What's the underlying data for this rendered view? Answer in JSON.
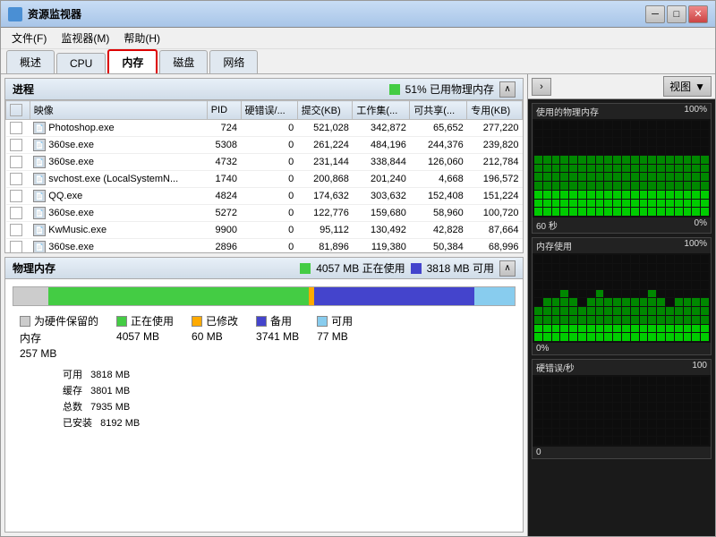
{
  "window": {
    "title": "资源监视器",
    "controls": {
      "minimize": "─",
      "maximize": "□",
      "close": "✕"
    }
  },
  "menu": {
    "items": [
      "文件(F)",
      "监视器(M)",
      "帮助(H)"
    ]
  },
  "tabs": [
    {
      "id": "overview",
      "label": "概述"
    },
    {
      "id": "cpu",
      "label": "CPU"
    },
    {
      "id": "memory",
      "label": "内存",
      "active": true
    },
    {
      "id": "disk",
      "label": "磁盘"
    },
    {
      "id": "network",
      "label": "网络"
    }
  ],
  "process_section": {
    "title": "进程",
    "memory_percent": "51% 已用物理内存",
    "columns": [
      "映像",
      "PID",
      "硬错误/...",
      "提交(KB)",
      "工作集(...",
      "可共享(...",
      "专用(KB)"
    ],
    "rows": [
      {
        "name": "Photoshop.exe",
        "pid": "724",
        "hard_fault": "0",
        "commit": "521,028",
        "working": "342,872",
        "shareable": "65,652",
        "private": "277,220"
      },
      {
        "name": "360se.exe",
        "pid": "5308",
        "hard_fault": "0",
        "commit": "261,224",
        "working": "484,196",
        "shareable": "244,376",
        "private": "239,820"
      },
      {
        "name": "360se.exe",
        "pid": "4732",
        "hard_fault": "0",
        "commit": "231,144",
        "working": "338,844",
        "shareable": "126,060",
        "private": "212,784"
      },
      {
        "name": "svchost.exe (LocalSystemN...",
        "pid": "1740",
        "hard_fault": "0",
        "commit": "200,868",
        "working": "201,240",
        "shareable": "4,668",
        "private": "196,572"
      },
      {
        "name": "QQ.exe",
        "pid": "4824",
        "hard_fault": "0",
        "commit": "174,632",
        "working": "303,632",
        "shareable": "152,408",
        "private": "151,224"
      },
      {
        "name": "360se.exe",
        "pid": "5272",
        "hard_fault": "0",
        "commit": "122,776",
        "working": "159,680",
        "shareable": "58,960",
        "private": "100,720"
      },
      {
        "name": "KwMusic.exe",
        "pid": "9900",
        "hard_fault": "0",
        "commit": "95,112",
        "working": "130,492",
        "shareable": "42,828",
        "private": "87,664"
      },
      {
        "name": "360se.exe",
        "pid": "2896",
        "hard_fault": "0",
        "commit": "81,896",
        "working": "119,380",
        "shareable": "50,384",
        "private": "68,996"
      }
    ]
  },
  "physical_memory": {
    "title": "物理内存",
    "in_use_label": "4057 MB 正在使用",
    "available_label": "3818 MB 可用",
    "legend": {
      "hardware_label": "为硬件保留的\n内存",
      "hardware_value": "257 MB",
      "inuse_label": "正在使用",
      "inuse_value": "4057 MB",
      "modified_label": "已修改",
      "modified_value": "60 MB",
      "standby_label": "备用",
      "standby_value": "3741 MB",
      "free_label": "可用",
      "free_value": "77 MB"
    },
    "stats": {
      "available_label": "可用",
      "available_value": "3818 MB",
      "cached_label": "缓存",
      "cached_value": "3801 MB",
      "total_label": "总数",
      "total_value": "7935 MB",
      "installed_label": "已安装",
      "installed_value": "8192 MB"
    }
  },
  "right_panel": {
    "graphs": [
      {
        "id": "physical_memory_used",
        "label_left": "使用的物理内存",
        "label_right": "100%",
        "label_bottom": "0%",
        "time_label": "60 秒"
      },
      {
        "id": "memory_usage",
        "label_left": "内存使用",
        "label_right": "100%",
        "label_bottom": "0%"
      },
      {
        "id": "hard_fault",
        "label_left": "硬错误/秒",
        "label_right": "100",
        "label_bottom": "0"
      }
    ],
    "view_label": "视图"
  }
}
